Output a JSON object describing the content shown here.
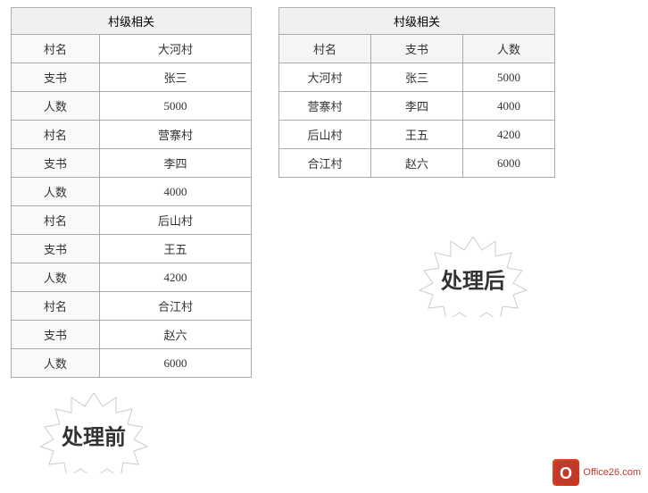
{
  "left": {
    "title": "村级相关",
    "rows": [
      {
        "label": "村名",
        "value": "大河村"
      },
      {
        "label": "支书",
        "value": "张三"
      },
      {
        "label": "人数",
        "value": "5000"
      },
      {
        "label": "村名",
        "value": "营寨村"
      },
      {
        "label": "支书",
        "value": "李四"
      },
      {
        "label": "人数",
        "value": "4000"
      },
      {
        "label": "村名",
        "value": "后山村"
      },
      {
        "label": "支书",
        "value": "王五"
      },
      {
        "label": "人数",
        "value": "4200"
      },
      {
        "label": "村名",
        "value": "合江村"
      },
      {
        "label": "支书",
        "value": "赵六"
      },
      {
        "label": "人数",
        "value": "6000"
      }
    ],
    "stamp": "处理前"
  },
  "right": {
    "title": "村级相关",
    "headers": [
      "村名",
      "支书",
      "人数"
    ],
    "rows": [
      [
        "大河村",
        "张三",
        "5000"
      ],
      [
        "营寨村",
        "李四",
        "4000"
      ],
      [
        "后山村",
        "王五",
        "4200"
      ],
      [
        "合江村",
        "赵六",
        "6000"
      ]
    ],
    "stamp": "处理后"
  },
  "office": {
    "logo_letter": "O",
    "site_text": "Office26.com"
  }
}
